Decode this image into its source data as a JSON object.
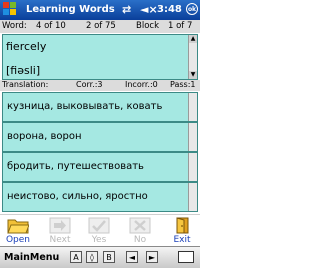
{
  "titlebar": {
    "title": "Learning Words",
    "time": "3:48",
    "ok_label": "ok",
    "icons": [
      "windows-start-icon",
      "connectivity-icon",
      "volume-icon"
    ]
  },
  "info": {
    "word_label": "Word:",
    "word_pos": "4 of 10",
    "word_total": "2 of 75",
    "block_label": "Block",
    "block_pos": "1 of 7"
  },
  "word": {
    "text": "fiercely",
    "transcription": "[fiəsli]"
  },
  "status": {
    "translation_label": "Translation:",
    "correct": "Corr.:3",
    "incorrect": "Incorr.:0",
    "pass": "Pass:1"
  },
  "answers": [
    "кузница, выковывать, ковать",
    "ворона, ворон",
    "бродить, путешествовать",
    "неистово, сильно, яростно"
  ],
  "toolbar": {
    "open_label": "Open",
    "next_label": "Next",
    "yes_label": "Yes",
    "no_label": "No",
    "exit_label": "Exit"
  },
  "menubar": {
    "main_label": "MainMenu"
  },
  "colors": {
    "accent": "#0a3f9a",
    "panel": "#a5e8e2",
    "disabled": "#b8b8b8"
  }
}
